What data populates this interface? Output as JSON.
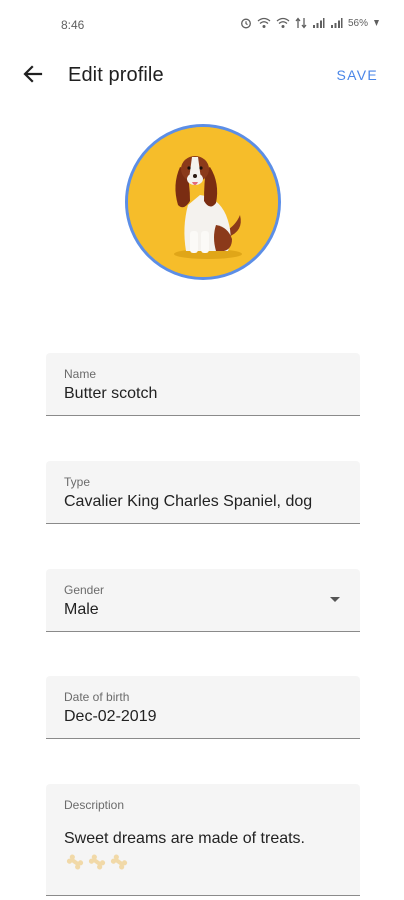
{
  "status_bar": {
    "time": "8:46",
    "battery": "56%",
    "icons": [
      "alarm-icon",
      "wifi-calling-icon",
      "wifi-calling-icon",
      "mobile-data-icon",
      "signal-icon",
      "signal-icon",
      "battery-icon"
    ]
  },
  "app_bar": {
    "back_icon": "arrow-left-icon",
    "title": "Edit profile",
    "save_label": "SAVE",
    "accent_color": "#4a86e8"
  },
  "avatar": {
    "background_color": "#f6bd2a",
    "ring_color": "#5c8ee6"
  },
  "form": {
    "name": {
      "label": "Name",
      "value": "Butter scotch"
    },
    "type": {
      "label": "Type",
      "value": "Cavalier King Charles Spaniel, dog"
    },
    "gender": {
      "label": "Gender",
      "value": "Male"
    },
    "date_of_birth": {
      "label": "Date of birth",
      "value": "Dec-02-2019"
    },
    "description": {
      "label": "Description",
      "value": "Sweet dreams are made of treats.",
      "emoji": "bone-emoji"
    }
  }
}
